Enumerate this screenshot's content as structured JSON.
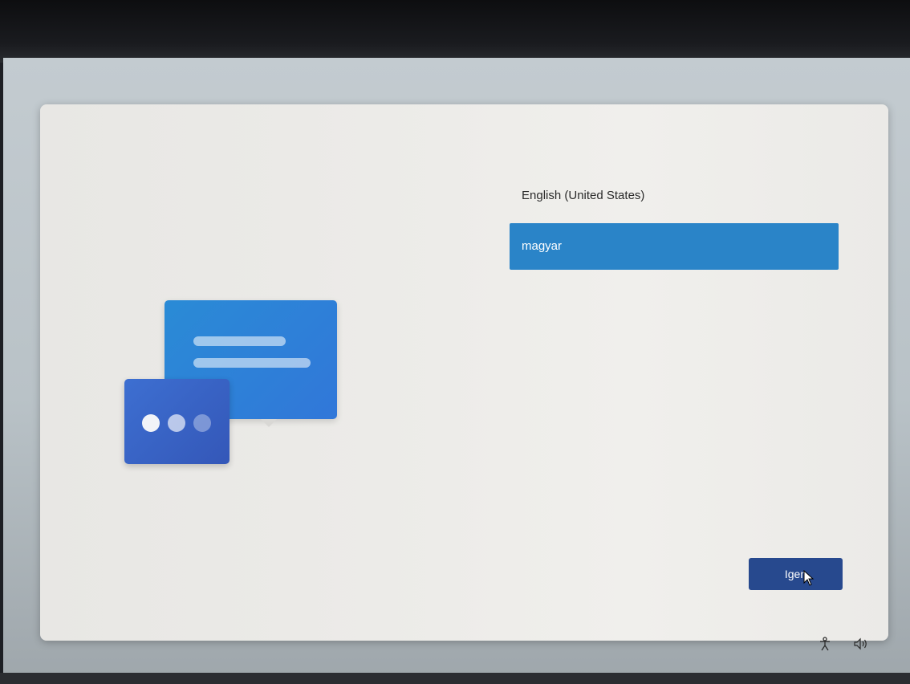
{
  "languages": [
    {
      "label": "English (United States)",
      "selected": false
    },
    {
      "label": "magyar",
      "selected": true
    }
  ],
  "next_button": {
    "label": "Igen"
  },
  "icons": {
    "illustration": "chat-bubbles-illustration",
    "pointer": "mouse-pointer-icon",
    "accessibility": "accessibility-icon",
    "volume": "volume-icon"
  },
  "colors": {
    "selected_item": "#2a84c8",
    "button": "#27498e",
    "illustration_primary": "#2a8bd6",
    "illustration_secondary": "#3457b8"
  }
}
